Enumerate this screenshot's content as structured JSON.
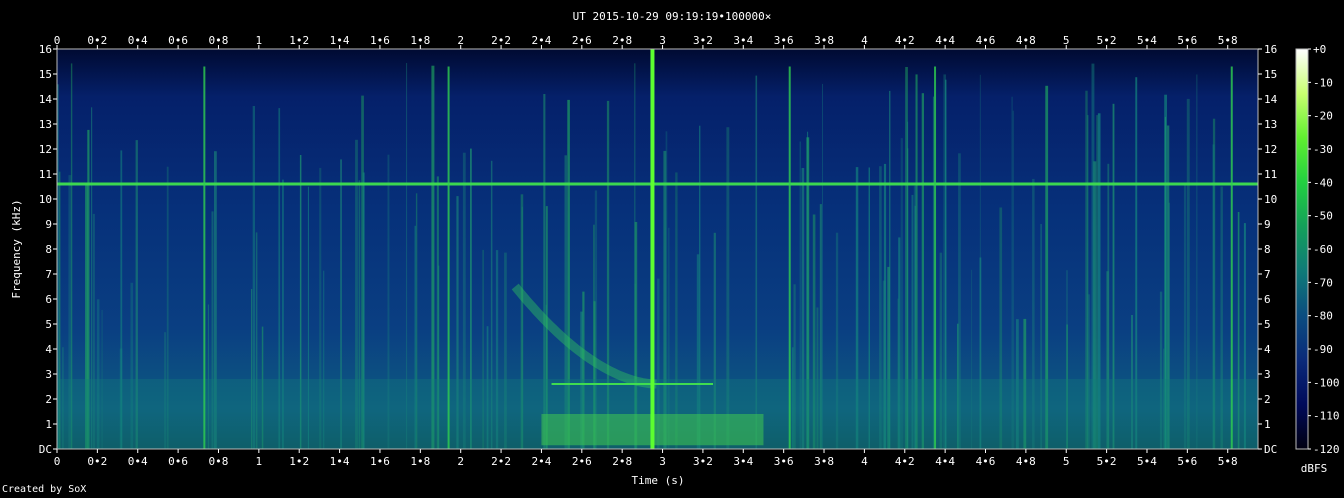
{
  "chart_data": {
    "type": "heatmap",
    "title": "UT 2015-10-29 09:19:19•100000×",
    "xlabel": "Time (s)",
    "ylabel": "Frequency (kHz)",
    "xlim": [
      0,
      5.95
    ],
    "ylim": [
      0,
      16
    ],
    "x_ticks": [
      "0",
      "0•2",
      "0•4",
      "0•6",
      "0•8",
      "1",
      "1•2",
      "1•4",
      "1•6",
      "1•8",
      "2",
      "2•2",
      "2•4",
      "2•6",
      "2•8",
      "3",
      "3•2",
      "3•4",
      "3•6",
      "3•8",
      "4",
      "4•2",
      "4•4",
      "4•6",
      "4•8",
      "5",
      "5•2",
      "5•4",
      "5•6",
      "5•8"
    ],
    "y_ticks": [
      "DC",
      "1",
      "2",
      "3",
      "4",
      "5",
      "6",
      "7",
      "8",
      "9",
      "10",
      "11",
      "12",
      "13",
      "14",
      "15",
      "16"
    ],
    "colorbar": {
      "label": "dBFS",
      "ticks": [
        "+0",
        "-10",
        "-20",
        "-30",
        "-40",
        "-50",
        "-60",
        "-70",
        "-80",
        "-90",
        "-100",
        "-110",
        "-120"
      ],
      "colors": [
        "#000010",
        "#000a5a",
        "#0a2a7a",
        "#0b4d80",
        "#0f7a78",
        "#14a05a",
        "#22d040",
        "#60f030",
        "#c8ff70",
        "#ffffff"
      ]
    },
    "features": {
      "tone_line_khz": 10.6,
      "strong_impulse_s": 2.95,
      "impulses_s": [
        0.73,
        1.94,
        3.63,
        4.35,
        5.82
      ],
      "whistler_start_s": 2.27,
      "whistler_end_s": 2.97,
      "whistler_start_khz": 6.5,
      "whistler_end_khz": 2.6
    }
  },
  "footer": {
    "credit": "Created by SoX"
  }
}
